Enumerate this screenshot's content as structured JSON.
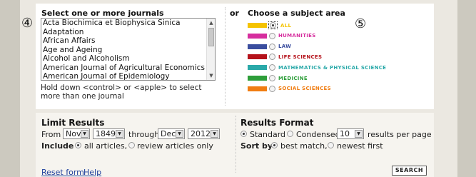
{
  "annotations": {
    "left_marker": "④",
    "right_marker": "⑤"
  },
  "journals": {
    "header": "Select one or more journals",
    "options": [
      "Acta Biochimica et Biophysica Sinica",
      "Adaptation",
      "African Affairs",
      "Age and Ageing",
      "Alcohol and Alcoholism",
      "American Journal of Agricultural Economics",
      "American Journal of Epidemiology"
    ],
    "hint": "Hold down <control> or <apple> to select more than one journal"
  },
  "or_label": "or",
  "subjects": {
    "header": "Choose a subject area",
    "items": [
      {
        "label": "ALL",
        "color": "#f5c300",
        "selected": true
      },
      {
        "label": "HUMANITIES",
        "color": "#d62e9e",
        "selected": false
      },
      {
        "label": "LAW",
        "color": "#3a4d9e",
        "selected": false
      },
      {
        "label": "LIFE SCIENCES",
        "color": "#b5121b",
        "selected": false
      },
      {
        "label": "MATHEMATICS & PHYSICAL SCIENCE",
        "color": "#2aa9a9",
        "selected": false
      },
      {
        "label": "MEDICINE",
        "color": "#2e9e3a",
        "selected": false
      },
      {
        "label": "SOCIAL SCIENCES",
        "color": "#f07d12",
        "selected": false
      }
    ]
  },
  "limit": {
    "header": "Limit Results",
    "from_label": "From",
    "from_month": "Nov",
    "from_year": "1849",
    "through_label": "through",
    "to_month": "Dec",
    "to_year": "2012",
    "include_label": "Include",
    "opt_all": "all articles,",
    "opt_review": "review articles only"
  },
  "format": {
    "header": "Results Format",
    "opt_standard": "Standard",
    "opt_condensed": "Condensed",
    "per_page": "10",
    "per_page_label": "results per page",
    "sort_label": "Sort by",
    "opt_best": "best match,",
    "opt_newest": "newest first"
  },
  "footer": {
    "reset": "Reset form",
    "help": "Help",
    "search": "SEARCH"
  }
}
